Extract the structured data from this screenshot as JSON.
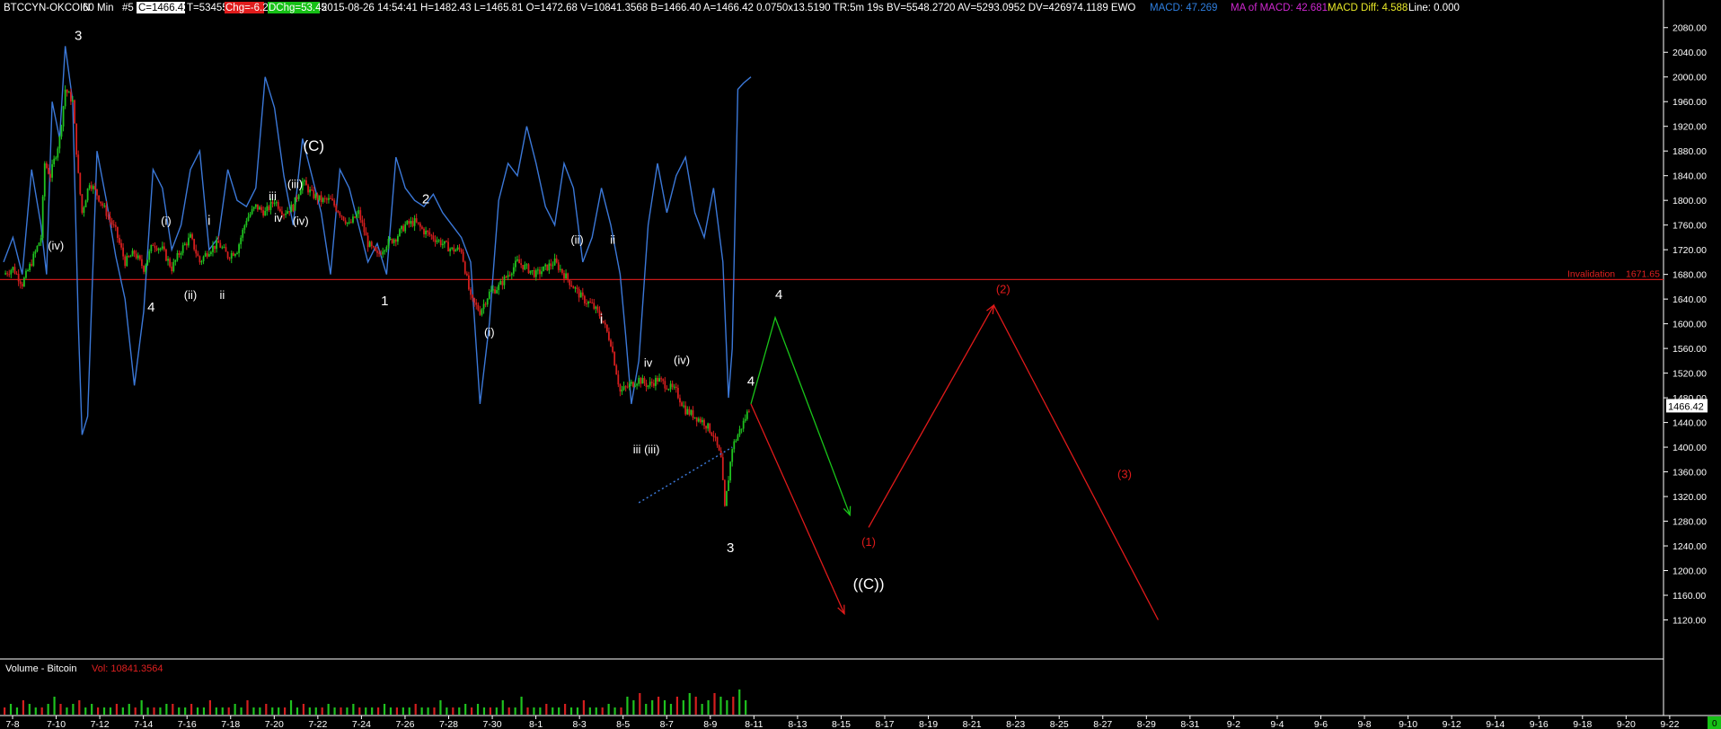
{
  "header": {
    "symbol": "BTCCYN-OKCOIN",
    "interval": "60 Min",
    "index": "#5",
    "close": "C=1466.42",
    "ticks": "T=53455",
    "chg": "Chg=-6.26",
    "dchg": "DChg=53.45",
    "info": "2015-08-26 14:54:41 H=1482.43 L=1465.81 O=1472.68 V=10841.3568 B=1466.40 A=1466.42 0.0750x13.5190 TR:5m 19s BV=5548.2720 AV=5293.0952 DV=426974.1189 EWO",
    "macd": "MACD: 47.269",
    "ma_macd": "MA of MACD: 42.681",
    "macd_diff": "MACD Diff: 4.588",
    "line": "Line: 0.000"
  },
  "volume_header": {
    "label": "Volume - Bitcoin",
    "vol": "Vol: 10841.3564"
  },
  "price_badge": "1466.42",
  "invalidation": {
    "label": "Invalidation",
    "value": "1671.65",
    "level": 1671.65
  },
  "colors": {
    "background": "#000000",
    "up_candle": "#1fc21f",
    "down_candle": "#d41e1e",
    "ewo_line": "#3b78d8",
    "invalidation_line": "#c81818",
    "projection_green": "#19c419",
    "projection_red": "#e01a1a",
    "macd_text": "#2f7fe0",
    "ma_macd_text": "#d028d0",
    "macd_diff_text": "#e8e828",
    "chg_bg": "#e01c1c",
    "dchg_bg": "#16c016"
  },
  "chart_data": {
    "type": "line",
    "ylim": [
      1080,
      2100
    ],
    "y_ticks": [
      2080,
      2040,
      2000,
      1960,
      1920,
      1880,
      1840,
      1800,
      1760,
      1720,
      1680,
      1640,
      1600,
      1560,
      1520,
      1480,
      1440,
      1400,
      1360,
      1320,
      1280,
      1240,
      1200,
      1160,
      1120
    ],
    "x_ticks": [
      "7-8",
      "7-10",
      "7-12",
      "7-14",
      "7-16",
      "7-18",
      "7-20",
      "7-22",
      "7-24",
      "7-26",
      "7-28",
      "7-30",
      "8-1",
      "8-3",
      "8-5",
      "8-7",
      "8-9",
      "8-11",
      "8-13",
      "8-15",
      "8-17",
      "8-19",
      "8-21",
      "8-23",
      "8-25",
      "8-27",
      "8-29",
      "8-31",
      "9-2",
      "9-4",
      "9-6",
      "9-8",
      "9-10",
      "9-12",
      "9-14",
      "9-16",
      "9-18",
      "9-20",
      "9-22"
    ],
    "volume_right_tick": "0",
    "price_path": [
      [
        0,
        1680
      ],
      [
        0.5,
        1690
      ],
      [
        1,
        1665
      ],
      [
        1.5,
        1700
      ],
      [
        2,
        1740
      ],
      [
        2.2,
        1860
      ],
      [
        2.5,
        1840
      ],
      [
        3,
        1900
      ],
      [
        3.3,
        1980
      ],
      [
        3.7,
        1960
      ],
      [
        4,
        1840
      ],
      [
        4.2,
        1780
      ],
      [
        4.6,
        1830
      ],
      [
        5,
        1810
      ],
      [
        5.5,
        1780
      ],
      [
        6,
        1750
      ],
      [
        6.5,
        1700
      ],
      [
        7,
        1715
      ],
      [
        7.5,
        1690
      ],
      [
        8,
        1730
      ],
      [
        8.5,
        1720
      ],
      [
        9,
        1690
      ],
      [
        9.5,
        1720
      ],
      [
        10,
        1740
      ],
      [
        10.5,
        1700
      ],
      [
        11,
        1720
      ],
      [
        11.5,
        1730
      ],
      [
        12,
        1710
      ],
      [
        12.5,
        1720
      ],
      [
        13,
        1770
      ],
      [
        13.5,
        1790
      ],
      [
        14,
        1780
      ],
      [
        14.5,
        1800
      ],
      [
        15,
        1780
      ],
      [
        15.5,
        1790
      ],
      [
        16,
        1830
      ],
      [
        16.5,
        1810
      ],
      [
        17,
        1800
      ],
      [
        17.5,
        1800
      ],
      [
        18,
        1780
      ],
      [
        18.5,
        1760
      ],
      [
        19,
        1780
      ],
      [
        19.5,
        1730
      ],
      [
        20,
        1710
      ],
      [
        20.5,
        1730
      ],
      [
        21,
        1740
      ],
      [
        21.5,
        1760
      ],
      [
        22,
        1765
      ],
      [
        22.5,
        1750
      ],
      [
        23,
        1740
      ],
      [
        23.5,
        1730
      ],
      [
        24,
        1720
      ],
      [
        24.5,
        1720
      ],
      [
        25,
        1640
      ],
      [
        25.5,
        1620
      ],
      [
        26,
        1650
      ],
      [
        26.5,
        1660
      ],
      [
        27,
        1680
      ],
      [
        27.5,
        1700
      ],
      [
        28,
        1690
      ],
      [
        28.5,
        1680
      ],
      [
        29,
        1690
      ],
      [
        29.5,
        1700
      ],
      [
        30,
        1680
      ],
      [
        30.5,
        1660
      ],
      [
        31,
        1640
      ],
      [
        31.5,
        1630
      ],
      [
        32,
        1610
      ],
      [
        32.5,
        1570
      ],
      [
        33,
        1490
      ],
      [
        33.5,
        1500
      ],
      [
        34,
        1510
      ],
      [
        34.5,
        1500
      ],
      [
        35,
        1510
      ],
      [
        35.5,
        1500
      ],
      [
        36,
        1490
      ],
      [
        36.5,
        1460
      ],
      [
        37,
        1450
      ],
      [
        37.5,
        1440
      ],
      [
        38,
        1420
      ],
      [
        38.4,
        1380
      ],
      [
        38.6,
        1300
      ],
      [
        39,
        1400
      ],
      [
        39.3,
        1420
      ],
      [
        39.6,
        1440
      ],
      [
        40,
        1470
      ]
    ],
    "ewo_path": [
      [
        0,
        1700
      ],
      [
        0.5,
        1740
      ],
      [
        1,
        1680
      ],
      [
        1.5,
        1850
      ],
      [
        2,
        1760
      ],
      [
        2.3,
        1680
      ],
      [
        2.6,
        1960
      ],
      [
        3,
        1900
      ],
      [
        3.3,
        2050
      ],
      [
        3.7,
        1960
      ],
      [
        4,
        1600
      ],
      [
        4.2,
        1420
      ],
      [
        4.5,
        1450
      ],
      [
        5,
        1880
      ],
      [
        5.5,
        1800
      ],
      [
        6,
        1710
      ],
      [
        6.5,
        1640
      ],
      [
        7,
        1500
      ],
      [
        7.5,
        1620
      ],
      [
        8,
        1850
      ],
      [
        8.5,
        1820
      ],
      [
        9,
        1720
      ],
      [
        9.5,
        1760
      ],
      [
        10,
        1850
      ],
      [
        10.5,
        1880
      ],
      [
        11,
        1720
      ],
      [
        11.5,
        1740
      ],
      [
        12,
        1850
      ],
      [
        12.5,
        1800
      ],
      [
        13,
        1790
      ],
      [
        13.5,
        1820
      ],
      [
        14,
        2000
      ],
      [
        14.5,
        1950
      ],
      [
        15,
        1840
      ],
      [
        15.5,
        1760
      ],
      [
        16,
        1900
      ],
      [
        16.5,
        1840
      ],
      [
        17,
        1780
      ],
      [
        17.5,
        1680
      ],
      [
        18,
        1850
      ],
      [
        18.5,
        1820
      ],
      [
        19,
        1760
      ],
      [
        19.5,
        1700
      ],
      [
        20,
        1730
      ],
      [
        20.5,
        1680
      ],
      [
        21,
        1870
      ],
      [
        21.5,
        1820
      ],
      [
        22,
        1800
      ],
      [
        22.5,
        1790
      ],
      [
        23,
        1810
      ],
      [
        23.5,
        1780
      ],
      [
        24,
        1760
      ],
      [
        24.5,
        1740
      ],
      [
        25,
        1700
      ],
      [
        25.5,
        1470
      ],
      [
        26,
        1600
      ],
      [
        26.5,
        1800
      ],
      [
        27,
        1860
      ],
      [
        27.5,
        1840
      ],
      [
        28,
        1920
      ],
      [
        28.5,
        1860
      ],
      [
        29,
        1790
      ],
      [
        29.5,
        1760
      ],
      [
        30,
        1860
      ],
      [
        30.5,
        1820
      ],
      [
        31,
        1700
      ],
      [
        31.5,
        1740
      ],
      [
        32,
        1820
      ],
      [
        32.5,
        1760
      ],
      [
        33,
        1680
      ],
      [
        33.3,
        1580
      ],
      [
        33.6,
        1470
      ],
      [
        34,
        1540
      ],
      [
        34.5,
        1760
      ],
      [
        35,
        1860
      ],
      [
        35.5,
        1780
      ],
      [
        36,
        1840
      ],
      [
        36.5,
        1870
      ],
      [
        37,
        1780
      ],
      [
        37.5,
        1740
      ],
      [
        38,
        1820
      ],
      [
        38.5,
        1700
      ],
      [
        38.8,
        1480
      ],
      [
        39,
        1560
      ],
      [
        39.3,
        1980
      ],
      [
        39.6,
        1990
      ],
      [
        40,
        2000
      ]
    ],
    "support_line": [
      [
        34,
        1310
      ],
      [
        39,
        1400
      ]
    ],
    "green_projection": [
      [
        40,
        1470
      ],
      [
        41.3,
        1610
      ],
      [
        45.3,
        1290
      ]
    ],
    "red_projection_1": [
      [
        40,
        1470
      ],
      [
        45,
        1130
      ]
    ],
    "red_projection_2": [
      [
        46.3,
        1270
      ],
      [
        53,
        1630
      ],
      [
        61.8,
        1120
      ]
    ],
    "wave_labels": [
      {
        "t": "3",
        "x": 4.0,
        "y": 2060
      },
      {
        "t": "(iv)",
        "x": 2.8,
        "y": 1720
      },
      {
        "t": "4",
        "x": 7.9,
        "y": 1620
      },
      {
        "t": "(i)",
        "x": 8.7,
        "y": 1760
      },
      {
        "t": "(ii)",
        "x": 10.0,
        "y": 1640
      },
      {
        "t": "i",
        "x": 11.0,
        "y": 1760
      },
      {
        "t": "ii",
        "x": 11.7,
        "y": 1640
      },
      {
        "t": "iii",
        "x": 14.4,
        "y": 1800
      },
      {
        "t": "iv",
        "x": 14.7,
        "y": 1765
      },
      {
        "t": "(iii)",
        "x": 15.6,
        "y": 1820
      },
      {
        "t": "(iv)",
        "x": 15.9,
        "y": 1760
      },
      {
        "t": "(C)",
        "x": 16.6,
        "y": 1880
      },
      {
        "t": "1",
        "x": 20.4,
        "y": 1630
      },
      {
        "t": "2",
        "x": 22.6,
        "y": 1795
      },
      {
        "t": "(i)",
        "x": 26.0,
        "y": 1580
      },
      {
        "t": "(ii)",
        "x": 30.7,
        "y": 1730
      },
      {
        "t": "ii",
        "x": 32.6,
        "y": 1730
      },
      {
        "t": "i",
        "x": 32.0,
        "y": 1600
      },
      {
        "t": "iv",
        "x": 34.5,
        "y": 1530
      },
      {
        "t": "(iv)",
        "x": 36.3,
        "y": 1535
      },
      {
        "t": "iii",
        "x": 33.9,
        "y": 1390
      },
      {
        "t": "(iii)",
        "x": 34.7,
        "y": 1390
      },
      {
        "t": "4",
        "x": 40.0,
        "y": 1500
      },
      {
        "t": "3",
        "x": 38.9,
        "y": 1230
      },
      {
        "t": "4",
        "x": 41.5,
        "y": 1640
      },
      {
        "t": "(1)",
        "x": 46.3,
        "y": 1240
      },
      {
        "t": "((C))",
        "x": 46.3,
        "y": 1170
      },
      {
        "t": "(2)",
        "x": 53.5,
        "y": 1650
      },
      {
        "t": "(3)",
        "x": 60.0,
        "y": 1350
      }
    ],
    "volume_bars": [
      2,
      3,
      2,
      4,
      3,
      2,
      2,
      3,
      5,
      3,
      2,
      3,
      4,
      2,
      3,
      2,
      2,
      2,
      3,
      2,
      3,
      2,
      4,
      2,
      2,
      2,
      3,
      3,
      2,
      2,
      3,
      2,
      2,
      4,
      2,
      2,
      2,
      3,
      2,
      4,
      2,
      2,
      3,
      2,
      2,
      2,
      4,
      2,
      3,
      2,
      2,
      2,
      3,
      2,
      2,
      2,
      3,
      2,
      2,
      2,
      2,
      3,
      2,
      2,
      2,
      2,
      3,
      2,
      2,
      2,
      4,
      2,
      2,
      2,
      3,
      2,
      3,
      2,
      2,
      2,
      4,
      2,
      2,
      5,
      2,
      2,
      2,
      3,
      2,
      2,
      3,
      2,
      2,
      4,
      2,
      2,
      2,
      3,
      2,
      2,
      5,
      4,
      6,
      3,
      4,
      5,
      4,
      3,
      5,
      4,
      6,
      5,
      3,
      4,
      6,
      5,
      4,
      5,
      7,
      4
    ]
  }
}
